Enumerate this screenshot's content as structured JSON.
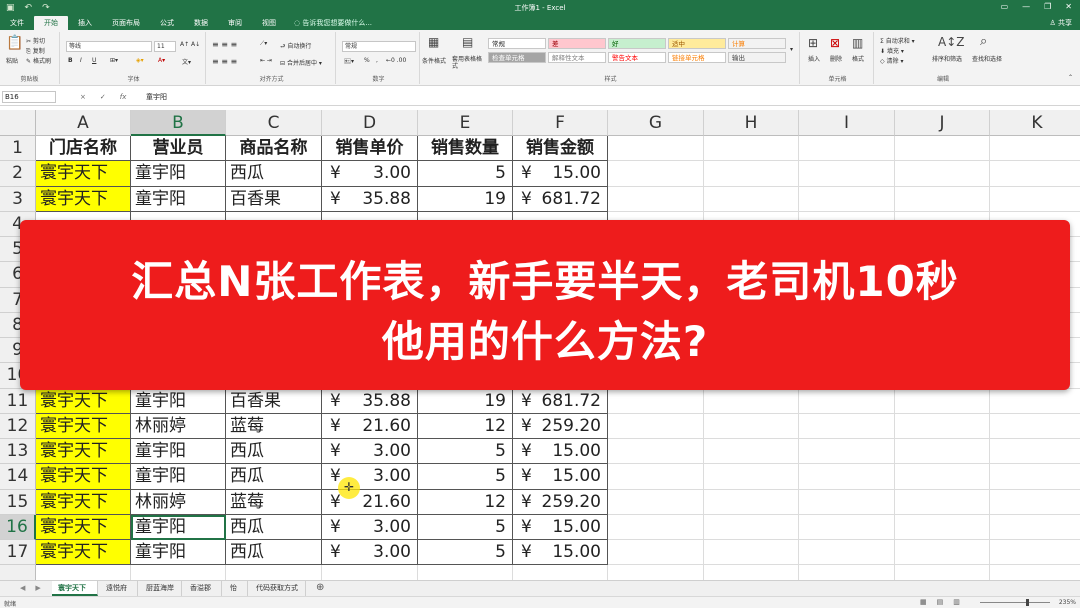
{
  "app": {
    "title": "工作簿1 - Excel",
    "qat_icons": [
      "save-icon",
      "undo-icon",
      "redo-icon"
    ]
  },
  "tabs": {
    "items": [
      "文件",
      "开始",
      "插入",
      "页面布局",
      "公式",
      "数据",
      "审阅",
      "视图"
    ],
    "active": "开始",
    "tell_me": "告诉我您想要做什么...",
    "share": "共享"
  },
  "ribbon": {
    "clipboard": {
      "label": "剪贴板",
      "paste": "粘贴",
      "cut": "剪切",
      "copy": "复制",
      "format_painter": "格式刷"
    },
    "font": {
      "label": "字体",
      "name": "等线",
      "size": "11",
      "bold": "B",
      "italic": "I",
      "underline": "U"
    },
    "alignment": {
      "label": "对齐方式",
      "wrap": "自动换行",
      "merge": "合并后居中"
    },
    "number": {
      "label": "数字",
      "format": "常规",
      "percent": "%"
    },
    "styles": {
      "label": "样式",
      "conditional": "条件格式",
      "table_format": "套用表格格式",
      "cells": [
        {
          "text": "常规",
          "bg": "#ffffff",
          "color": "#222222"
        },
        {
          "text": "差",
          "bg": "#ffc7ce",
          "color": "#9c0006"
        },
        {
          "text": "好",
          "bg": "#c6efce",
          "color": "#006100"
        },
        {
          "text": "适中",
          "bg": "#ffeb9c",
          "color": "#9c5700"
        },
        {
          "text": "计算",
          "bg": "#f2f2f2",
          "color": "#fa7d00"
        },
        {
          "text": "检查单元格",
          "bg": "#a5a5a5",
          "color": "#ffffff"
        },
        {
          "text": "解释性文本",
          "bg": "#ffffff",
          "color": "#7f7f7f"
        },
        {
          "text": "警告文本",
          "bg": "#ffffff",
          "color": "#ff0000"
        },
        {
          "text": "链接单元格",
          "bg": "#ffffff",
          "color": "#fa7d00"
        },
        {
          "text": "输出",
          "bg": "#f2f2f2",
          "color": "#3f3f3f"
        }
      ]
    },
    "cells_group": {
      "label": "单元格",
      "insert": "插入",
      "delete": "删除",
      "format": "格式"
    },
    "editing": {
      "label": "编辑",
      "autosum": "自动求和",
      "fill": "填充",
      "clear": "清除",
      "sort": "排序和筛选",
      "find": "查找和选择"
    }
  },
  "formula_bar": {
    "name_box": "B16",
    "content": "童宇阳",
    "cancel": "×",
    "enter": "✓",
    "fx": "fx"
  },
  "columns": [
    "A",
    "B",
    "C",
    "D",
    "E",
    "F",
    "G",
    "H",
    "I",
    "J",
    "K"
  ],
  "rows": {
    "header": {
      "n": "1",
      "cells": [
        "门店名称",
        "营业员",
        "商品名称",
        "销售单价",
        "销售数量",
        "销售金额"
      ]
    },
    "data": [
      {
        "n": "2",
        "store": "寰宇天下",
        "clerk": "童宇阳",
        "item": "西瓜",
        "cur1": "¥",
        "price": "3.00",
        "qty": "5",
        "cur2": "¥",
        "amount": "15.00"
      },
      {
        "n": "3",
        "store": "寰宇天下",
        "clerk": "童宇阳",
        "item": "百香果",
        "cur1": "¥",
        "price": "35.88",
        "qty": "19",
        "cur2": "¥",
        "amount": "681.72"
      },
      {
        "n": "11",
        "store": "寰宇天下",
        "clerk": "童宇阳",
        "item": "百香果",
        "cur1": "¥",
        "price": "35.88",
        "qty": "19",
        "cur2": "¥",
        "amount": "681.72"
      },
      {
        "n": "12",
        "store": "寰宇天下",
        "clerk": "林丽婷",
        "item": "蓝莓",
        "cur1": "¥",
        "price": "21.60",
        "qty": "12",
        "cur2": "¥",
        "amount": "259.20"
      },
      {
        "n": "13",
        "store": "寰宇天下",
        "clerk": "童宇阳",
        "item": "西瓜",
        "cur1": "¥",
        "price": "3.00",
        "qty": "5",
        "cur2": "¥",
        "amount": "15.00"
      },
      {
        "n": "14",
        "store": "寰宇天下",
        "clerk": "童宇阳",
        "item": "西瓜",
        "cur1": "¥",
        "price": "3.00",
        "qty": "5",
        "cur2": "¥",
        "amount": "15.00"
      },
      {
        "n": "15",
        "store": "寰宇天下",
        "clerk": "林丽婷",
        "item": "蓝莓",
        "cur1": "¥",
        "price": "21.60",
        "qty": "12",
        "cur2": "¥",
        "amount": "259.20"
      },
      {
        "n": "16",
        "store": "寰宇天下",
        "clerk": "童宇阳",
        "item": "西瓜",
        "cur1": "¥",
        "price": "3.00",
        "qty": "5",
        "cur2": "¥",
        "amount": "15.00"
      },
      {
        "n": "17",
        "store": "寰宇天下",
        "clerk": "童宇阳",
        "item": "西瓜",
        "cur1": "¥",
        "price": "3.00",
        "qty": "5",
        "cur2": "¥",
        "amount": "15.00"
      }
    ],
    "hidden_under_banner": [
      "4",
      "5",
      "6",
      "7",
      "8",
      "9",
      "10"
    ]
  },
  "banner": {
    "line1": "汇总N张工作表，新手要半天，老司机10秒",
    "line2": "他用的什么方法?"
  },
  "sheet_tabs": [
    "寰宇天下",
    "遠悦府",
    "厨蓝海岸",
    "香溢郡",
    "怡园",
    "代码获取方式"
  ],
  "active_sheet": "寰宇天下",
  "status": {
    "ready": "就绪",
    "zoom": "235%"
  },
  "colors": {
    "excel_green": "#217346",
    "banner_red": "#ee1c1c",
    "highlight_yellow": "#ffff00"
  }
}
